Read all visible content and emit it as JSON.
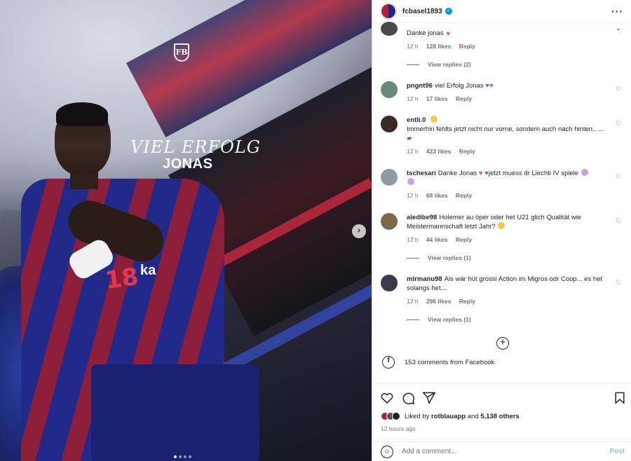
{
  "media": {
    "overlay_title": "VIEL ERFOLG",
    "overlay_name": "JONAS",
    "jersey_number": "18",
    "sponsor": "ka",
    "logo_letters": "FB",
    "carousel_next": "›",
    "dots": 4,
    "active_dot": 0
  },
  "header": {
    "username": "fcbasel1893",
    "verified_icon": "check-badge-icon",
    "more": "···"
  },
  "comments": [
    {
      "user": "",
      "text": "Danke jonas",
      "emoji": "heart-pink",
      "time": "12 h",
      "likes": "128 likes",
      "reply": "Reply",
      "replies": "View replies (2)",
      "avatar_color": "#4a4a4a"
    },
    {
      "user": "pngnt96",
      "text": "viel Erfolg Jonas",
      "emoji": "hearts-blue-pink",
      "time": "12 h",
      "likes": "17 likes",
      "reply": "Reply",
      "avatar_color": "#6a8a7a"
    },
    {
      "user": "entli.0",
      "text": "Immerhin fehlts jetzt nicht nur vorne, sondern auch nach hinten.. ...",
      "emoji": "face-emoji",
      "time": "12 h",
      "likes": "423 likes",
      "reply": "Reply",
      "avatar_color": "#3b2a2a"
    },
    {
      "user": "tschesari",
      "text": "Danke Jonas",
      "text2": "jetzt muess dr Liechti IV spiele",
      "emoji": "hearts-blue",
      "time": "12 h",
      "likes": "68 likes",
      "reply": "Reply",
      "avatar_color": "#8e9aa6"
    },
    {
      "user": "aledibe98",
      "text": "Holemer au öper oder het U21 glich Qualität wie Meistermannschaft letzt Jahr?",
      "emoji": "laugh-emoji",
      "time": "12 h",
      "likes": "44 likes",
      "reply": "Reply",
      "replies": "View replies (1)",
      "avatar_color": "#7a6a4a"
    },
    {
      "user": "mlrmanu98",
      "text": "Als wär hüt grossi Action im Migros odr Coop... es het solangs het...",
      "time": "12 h",
      "likes": "296 likes",
      "reply": "Reply",
      "replies": "View replies (1)",
      "avatar_color": "#3a3a4a"
    }
  ],
  "facebook": {
    "text": "153 comments from Facebook",
    "icon": "facebook-icon"
  },
  "actions": {
    "liked_by_prefix": "Liked by",
    "liked_by_user": "rotblauapp",
    "and": "and",
    "others": "5,138 others",
    "time_ago": "12 hours ago"
  },
  "add_comment": {
    "placeholder": "Add a comment...",
    "post": "Post"
  },
  "colors": {
    "accent": "#0095f6",
    "post_disabled": "#8ec6f5",
    "heart_pink": "#ff3d7f",
    "heart_blue": "#3b6fe0",
    "fcb_red": "#b3203a",
    "fcb_blue": "#1b2a8c"
  }
}
